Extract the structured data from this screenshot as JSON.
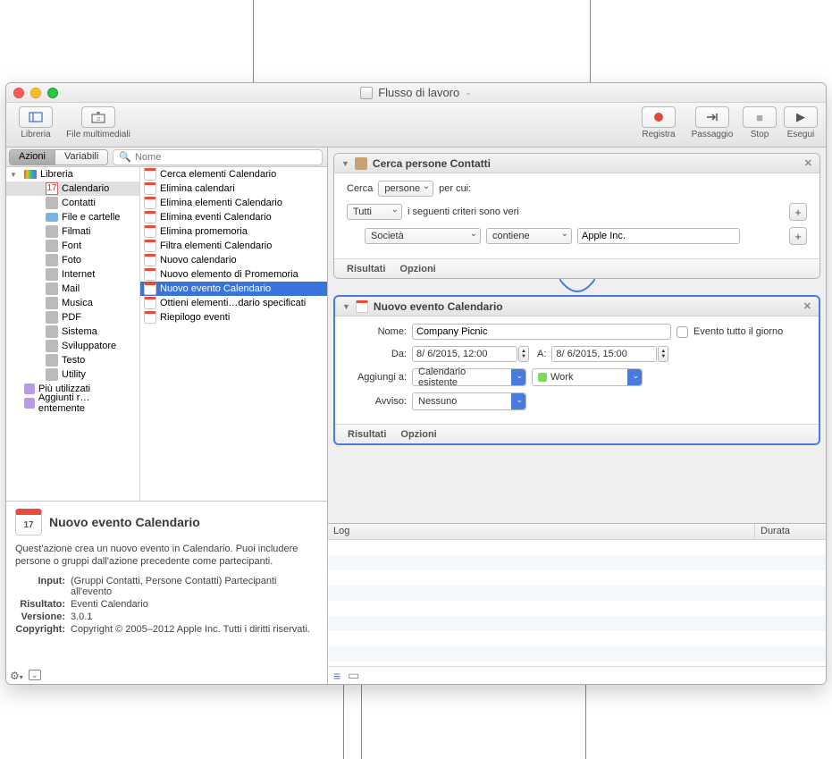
{
  "window": {
    "title": "Flusso di lavoro"
  },
  "toolbar": {
    "left": [
      {
        "name": "library",
        "label": "Libreria",
        "icon": "▢"
      },
      {
        "name": "media",
        "label": "File multimediali",
        "icon": "♫"
      }
    ],
    "right": [
      {
        "name": "record",
        "label": "Registra",
        "icon": "●"
      },
      {
        "name": "step",
        "label": "Passaggio",
        "icon": "→"
      },
      {
        "name": "stop",
        "label": "Stop",
        "icon": "■"
      },
      {
        "name": "run",
        "label": "Esegui",
        "icon": "▶"
      }
    ]
  },
  "segment": {
    "actions": "Azioni",
    "variables": "Variabili"
  },
  "search": {
    "placeholder": "Nome"
  },
  "categories": [
    {
      "name": "Libreria",
      "icon": "lib",
      "indent": 0,
      "expanded": true
    },
    {
      "name": "Calendario",
      "icon": "cal",
      "indent": 1,
      "selected": true
    },
    {
      "name": "Contatti",
      "icon": "contacts",
      "indent": 1
    },
    {
      "name": "File e cartelle",
      "icon": "folder",
      "indent": 1
    },
    {
      "name": "Filmati",
      "icon": "movies",
      "indent": 1
    },
    {
      "name": "Font",
      "icon": "font",
      "indent": 1
    },
    {
      "name": "Foto",
      "icon": "photos",
      "indent": 1
    },
    {
      "name": "Internet",
      "icon": "internet",
      "indent": 1
    },
    {
      "name": "Mail",
      "icon": "mail",
      "indent": 1
    },
    {
      "name": "Musica",
      "icon": "music",
      "indent": 1
    },
    {
      "name": "PDF",
      "icon": "pdf",
      "indent": 1
    },
    {
      "name": "Sistema",
      "icon": "system",
      "indent": 1
    },
    {
      "name": "Sviluppatore",
      "icon": "dev",
      "indent": 1
    },
    {
      "name": "Testo",
      "icon": "text",
      "indent": 1
    },
    {
      "name": "Utility",
      "icon": "utility",
      "indent": 1
    },
    {
      "name": "Più utilizzati",
      "icon": "purple",
      "indent": 0
    },
    {
      "name": "Aggiunti r…entemente",
      "icon": "purple",
      "indent": 0
    }
  ],
  "actions_list": [
    "Cerca elementi Calendario",
    "Elimina calendari",
    "Elimina elementi Calendario",
    "Elimina eventi Calendario",
    "Elimina promemoria",
    "Filtra elementi Calendario",
    "Nuovo calendario",
    "Nuovo elemento di Promemoria",
    "Nuovo evento Calendario",
    "Ottieni elementi…dario specificati",
    "Riepilogo eventi"
  ],
  "actions_selected_index": 8,
  "info": {
    "title": "Nuovo evento Calendario",
    "icon_day": "17",
    "desc": "Quest'azione crea un nuovo evento in Calendario. Puoi includere persone o gruppi dall'azione precedente come partecipanti.",
    "input_label": "Input:",
    "input_value": "(Gruppi Contatti, Persone Contatti) Partecipanti all'evento",
    "result_label": "Risultato:",
    "result_value": "Eventi Calendario",
    "version_label": "Versione:",
    "version_value": "3.0.1",
    "copyright_label": "Copyright:",
    "copyright_value": "Copyright © 2005–2012 Apple Inc. Tutti i diritti riservati."
  },
  "wf": {
    "a1": {
      "title": "Cerca persone Contatti",
      "find_lbl": "Cerca",
      "find_sel": "persone",
      "whose": "per cui:",
      "scope": "Tutti",
      "scope_after": "i seguenti criteri sono veri",
      "field": "Società",
      "op": "contiene",
      "value": "Apple Inc.",
      "results": "Risultati",
      "options": "Opzioni"
    },
    "a2": {
      "title": "Nuovo evento Calendario",
      "name_lbl": "Nome:",
      "name_val": "Company Picnic",
      "allday": "Evento tutto il giorno",
      "from_lbl": "Da:",
      "from_val": "8/  6/2015, 12:00",
      "to_lbl": "A:",
      "to_val": "8/  6/2015, 15:00",
      "addto_lbl": "Aggiungi a:",
      "addto_sel": "Calendario esistente",
      "addto_cal": "Work",
      "alarm_lbl": "Avviso:",
      "alarm_val": "Nessuno",
      "results": "Risultati",
      "options": "Opzioni"
    }
  },
  "log": {
    "col1": "Log",
    "col2": "Durata"
  }
}
